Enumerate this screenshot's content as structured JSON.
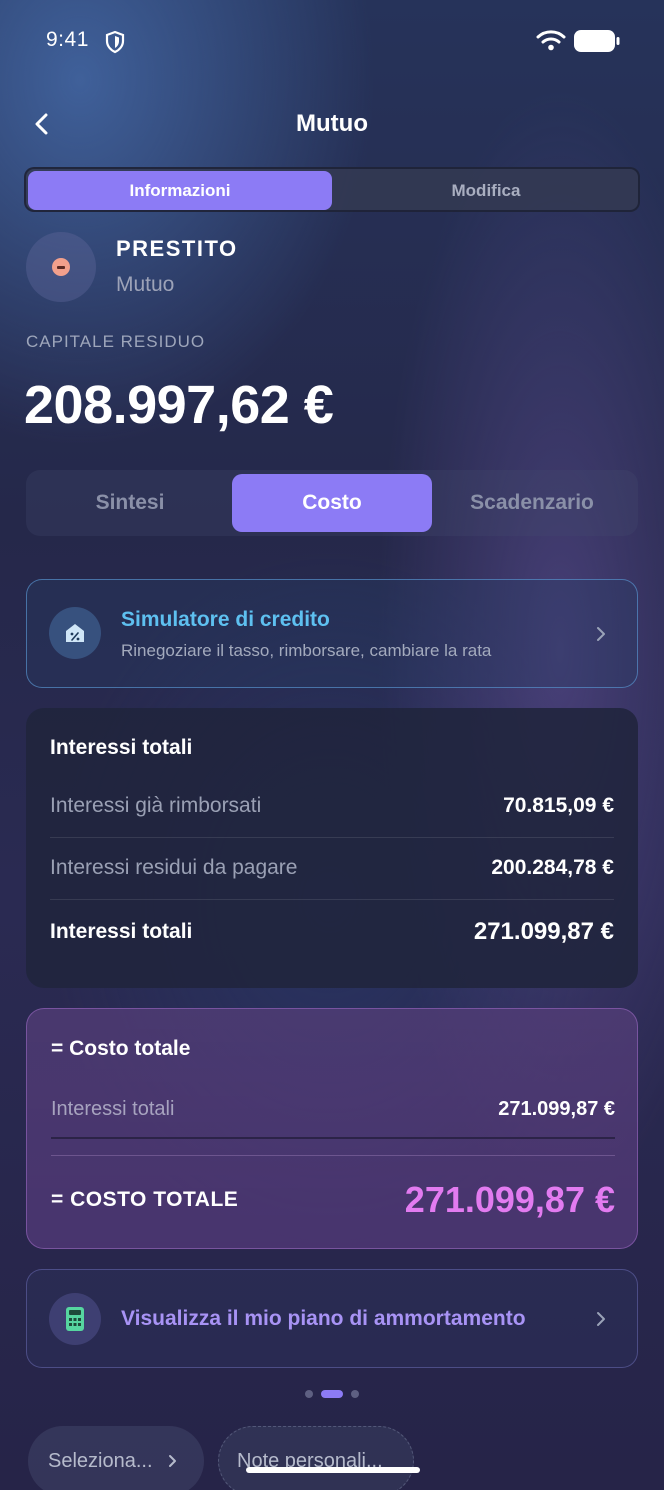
{
  "status_bar": {
    "time": "9:41"
  },
  "header": {
    "title": "Mutuo"
  },
  "top_tabs": [
    {
      "label": "Informazioni",
      "active": true
    },
    {
      "label": "Modifica",
      "active": false
    }
  ],
  "account": {
    "type": "PRESTITO",
    "name": "Mutuo",
    "icon": "minus-circle-icon"
  },
  "capital": {
    "label": "CAPITALE RESIDUO",
    "value": "208.997,62 €"
  },
  "section_tabs": [
    {
      "label": "Sintesi",
      "active": false
    },
    {
      "label": "Costo",
      "active": true
    },
    {
      "label": "Scadenzario",
      "active": false
    }
  ],
  "simulator": {
    "title": "Simulatore di credito",
    "subtitle": "Rinegoziare il tasso, rimborsare, cambiare la rata",
    "icon": "house-percent-icon"
  },
  "interests": {
    "title": "Interessi totali",
    "rows": [
      {
        "label": "Interessi già rimborsati",
        "value": "70.815,09 €"
      },
      {
        "label": "Interessi residui da pagare",
        "value": "200.284,78 €"
      }
    ],
    "total": {
      "label": "Interessi totali",
      "value": "271.099,87 €"
    }
  },
  "cost": {
    "title": "= Costo totale",
    "row": {
      "label": "Interessi totali",
      "value": "271.099,87 €"
    },
    "total": {
      "label": "= COSTO TOTALE",
      "value": "271.099,87 €"
    }
  },
  "amortization": {
    "label": "Visualizza il mio piano di ammortamento",
    "icon": "calculator-icon"
  },
  "pager": {
    "count": 3,
    "active": 1
  },
  "bottom_actions": {
    "select_label": "Seleziona...",
    "notes_placeholder": "Note personali..."
  },
  "colors": {
    "accent": "#8c7bf5",
    "simulator_title": "#5ec0f0",
    "cost_total": "#e27bf0",
    "account_icon": "#f2a08c"
  }
}
